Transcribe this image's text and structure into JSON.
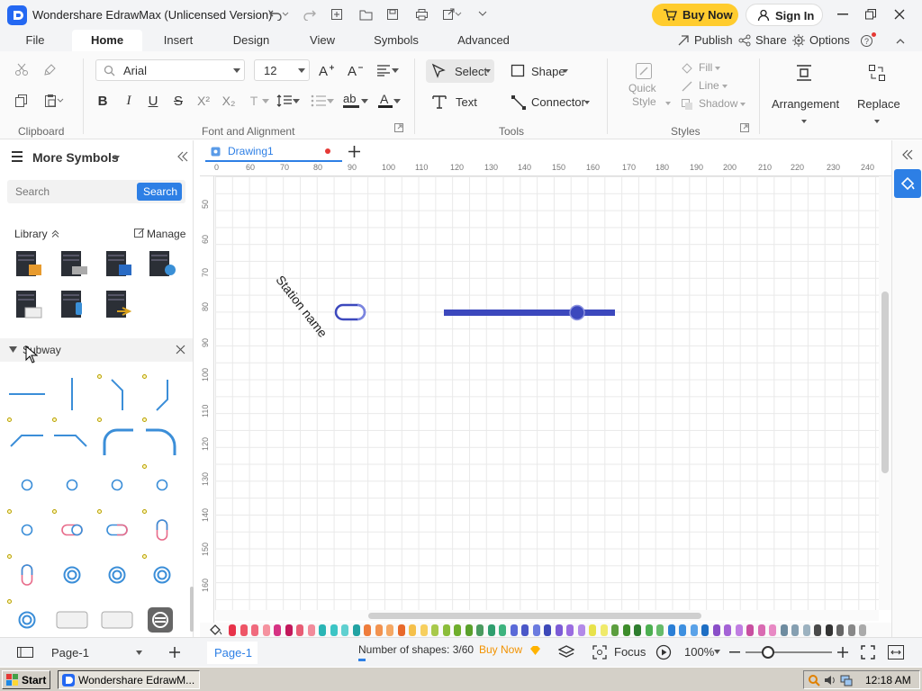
{
  "window": {
    "title": "Wondershare EdrawMax (Unlicensed Version)"
  },
  "titlebar": {
    "buy_now": "Buy Now",
    "sign_in": "Sign In"
  },
  "ribbon_tabs": [
    "File",
    "Home",
    "Insert",
    "Design",
    "View",
    "Symbols",
    "Advanced"
  ],
  "ribbon_right": {
    "publish": "Publish",
    "share": "Share",
    "options": "Options"
  },
  "ribbon": {
    "font_name": "Arial",
    "font_size": "12",
    "select": "Select",
    "shape": "Shape",
    "text": "Text",
    "connector": "Connector",
    "quick_style_1": "Quick",
    "quick_style_2": "Style",
    "fill": "Fill",
    "line": "Line",
    "shadow": "Shadow",
    "arrangement": "Arrangement",
    "replace": "Replace",
    "groups": {
      "clipboard": "Clipboard",
      "font": "Font and Alignment",
      "tools": "Tools",
      "styles": "Styles"
    }
  },
  "left_panel": {
    "title": "More Symbols",
    "search_placeholder": "Search",
    "search_button": "Search",
    "library": "Library",
    "manage": "Manage",
    "category": "Subway"
  },
  "document": {
    "tab": "Drawing1"
  },
  "canvas": {
    "label": "Station name",
    "ruler_h": [
      "0",
      "60",
      "70",
      "80",
      "90",
      "100",
      "110",
      "120",
      "130",
      "140",
      "150",
      "160",
      "170",
      "180",
      "190",
      "200",
      "210",
      "220",
      "230",
      "240"
    ],
    "ruler_v": [
      "50",
      "60",
      "70",
      "80",
      "90",
      "100",
      "110",
      "120",
      "130",
      "140",
      "150",
      "160"
    ]
  },
  "status": {
    "page_select": "Page-1",
    "page_tab": "Page-1",
    "shapes": "Number of shapes: 3/60",
    "buy_now": "Buy Now",
    "focus": "Focus",
    "zoom": "100%"
  },
  "taskbar": {
    "start": "Start",
    "app": "Wondershare EdrawM...",
    "clock": "12:18 AM"
  },
  "palette": [
    "#e8334a",
    "#ee5566",
    "#f06a7d",
    "#f5929f",
    "#d63384",
    "#c2185b",
    "#e85d75",
    "#f28b9b",
    "#2ab5b5",
    "#3cc5c5",
    "#5fd0d0",
    "#22a3a3",
    "#ef7d3c",
    "#f2924f",
    "#f5a864",
    "#e8692a",
    "#f5c04a",
    "#f7cf5e",
    "#a8c94a",
    "#8bbd3a",
    "#6fae2c",
    "#5aa02a",
    "#4a9a5f",
    "#2f9e6e",
    "#3db37e",
    "#5a6ad8",
    "#4a57c8",
    "#6b7bdf",
    "#3d49b8",
    "#7c5bd6",
    "#9a6ce0",
    "#b38ae8",
    "#e8e24a",
    "#f0ea6a",
    "#5c9e3e",
    "#3d8c2a",
    "#2e7d2e",
    "#4caf50",
    "#66bb6a",
    "#2b7fd6",
    "#3e90e0",
    "#5aa2e8",
    "#1e6fc4",
    "#8a4fc8",
    "#a463d6",
    "#c07ee2",
    "#c84fa0",
    "#d96bb2",
    "#e889c4",
    "#6e8ca0",
    "#859fb1",
    "#9cb2c0",
    "#4a4a4a",
    "#333333",
    "#666666",
    "#888888",
    "#aaaaaa"
  ]
}
